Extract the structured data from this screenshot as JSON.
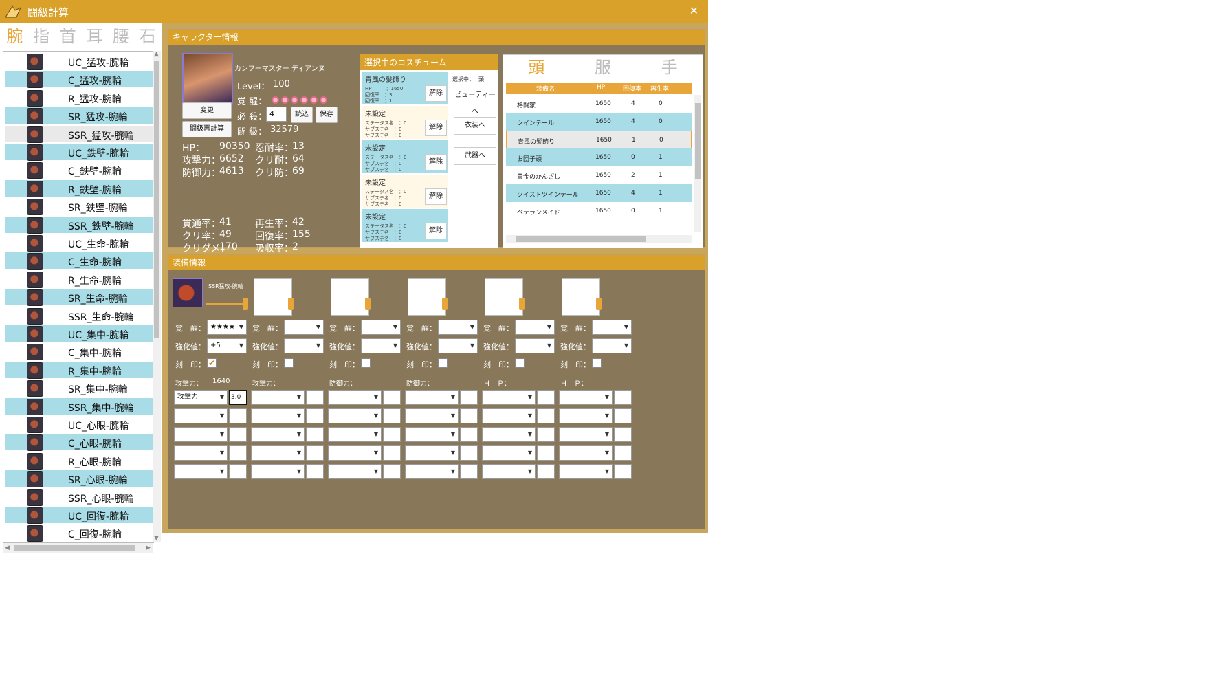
{
  "window": {
    "title": "闘級計算",
    "close_glyph": "✕"
  },
  "left": {
    "tabs": [
      "腕",
      "指",
      "首",
      "耳",
      "腰",
      "石"
    ],
    "active_tab": 0,
    "items": [
      "UC_猛攻-腕輪",
      "C_猛攻-腕輪",
      "R_猛攻-腕輪",
      "SR_猛攻-腕輪",
      "SSR_猛攻-腕輪",
      "UC_鉄壁-腕輪",
      "C_鉄壁-腕輪",
      "R_鉄壁-腕輪",
      "SR_鉄壁-腕輪",
      "SSR_鉄壁-腕輪",
      "UC_生命-腕輪",
      "C_生命-腕輪",
      "R_生命-腕輪",
      "SR_生命-腕輪",
      "SSR_生命-腕輪",
      "UC_集中-腕輪",
      "C_集中-腕輪",
      "R_集中-腕輪",
      "SR_集中-腕輪",
      "SSR_集中-腕輪",
      "UC_心眼-腕輪",
      "C_心眼-腕輪",
      "R_心眼-腕輪",
      "SR_心眼-腕輪",
      "SSR_心眼-腕輪",
      "UC_回復-腕輪",
      "C_回復-腕輪"
    ]
  },
  "char": {
    "header": "キャラクター情報",
    "name": "カンフーマスター ディアンヌ",
    "level_label": "Level：",
    "level": "100",
    "awaken_label": "覚 醒：",
    "awaken_stars": 6,
    "special_label": "必 殺：",
    "special_value": "4",
    "power_label": "闘 級：",
    "power": "32579",
    "buttons": {
      "change": "変更",
      "recalc": "闘級再計算",
      "load": "読込",
      "save": "保存"
    },
    "stats": [
      {
        "label": "HP：",
        "value": "90350"
      },
      {
        "label": "忍耐率：",
        "value": "13"
      },
      {
        "label": "攻撃力：",
        "value": "6652"
      },
      {
        "label": "クリ耐：",
        "value": "64"
      },
      {
        "label": "防御力：",
        "value": "4613"
      },
      {
        "label": "クリ防：",
        "value": "69"
      },
      {
        "label": "貫通率：",
        "value": "41"
      },
      {
        "label": "再生率：",
        "value": "42"
      },
      {
        "label": "クリ率：",
        "value": "49"
      },
      {
        "label": "回復率：",
        "value": "155"
      },
      {
        "label": "クリダメ：",
        "value": "170"
      },
      {
        "label": "吸収率：",
        "value": "2"
      }
    ]
  },
  "costume": {
    "header": "選択中のコスチューム",
    "selected_label": "選択中：",
    "selected_value": "頭",
    "slots": [
      {
        "name": "青風の髪飾り",
        "lines": [
          "HP　　　：1650",
          "回復率　：3",
          "回復率　：1"
        ]
      },
      {
        "name": "未設定",
        "lines": [
          "ステータス名　：0",
          "サブステ名　：0",
          "サブステ名　：0"
        ]
      },
      {
        "name": "未設定",
        "lines": [
          "ステータス名　：0",
          "サブステ名　：0",
          "サブステ名　：0"
        ]
      },
      {
        "name": "未設定",
        "lines": [
          "ステータス名　：0",
          "サブステ名　：0",
          "サブステ名　：0"
        ]
      },
      {
        "name": "未設定",
        "lines": [
          "ステータス名　：0",
          "サブステ名　：0",
          "サブステ名　：0"
        ]
      }
    ],
    "remove_label": "解除",
    "nav": [
      "ビューティーへ",
      "衣装へ",
      "武器へ"
    ]
  },
  "equip_list": {
    "tabs": [
      "頭",
      "服",
      "手"
    ],
    "active_tab": 0,
    "columns": [
      "装備名",
      "HP",
      "回復率",
      "再生率"
    ],
    "rows": [
      [
        "格闘家",
        "1650",
        "4",
        "0"
      ],
      [
        "ツインテール",
        "1650",
        "4",
        "0"
      ],
      [
        "青風の髪飾り",
        "1650",
        "1",
        "0"
      ],
      [
        "お団子頭",
        "1650",
        "0",
        "1"
      ],
      [
        "黄金のかんざし",
        "1650",
        "2",
        "1"
      ],
      [
        "ツイストツインテール",
        "1650",
        "4",
        "1"
      ],
      [
        "ベテランメイド",
        "1650",
        "0",
        "1"
      ]
    ],
    "selected_row": 2
  },
  "equip": {
    "header": "装備情報",
    "item_name": "SSR猛攻-腕輪",
    "awaken_label": "覚　醒：",
    "enhance_label": "強化値：",
    "seal_label": "刻　印：",
    "slot0": {
      "awaken": "★★★★",
      "enhance": "+5",
      "stat_label": "攻撃力：",
      "stat_value": "1640",
      "sub_first": "攻撃力",
      "sub_first_val": "3.0"
    },
    "stat_labels": [
      "攻撃力：",
      "防御力：",
      "防御力：",
      "Ｈ　Ｐ：",
      "Ｈ　Ｐ："
    ]
  }
}
